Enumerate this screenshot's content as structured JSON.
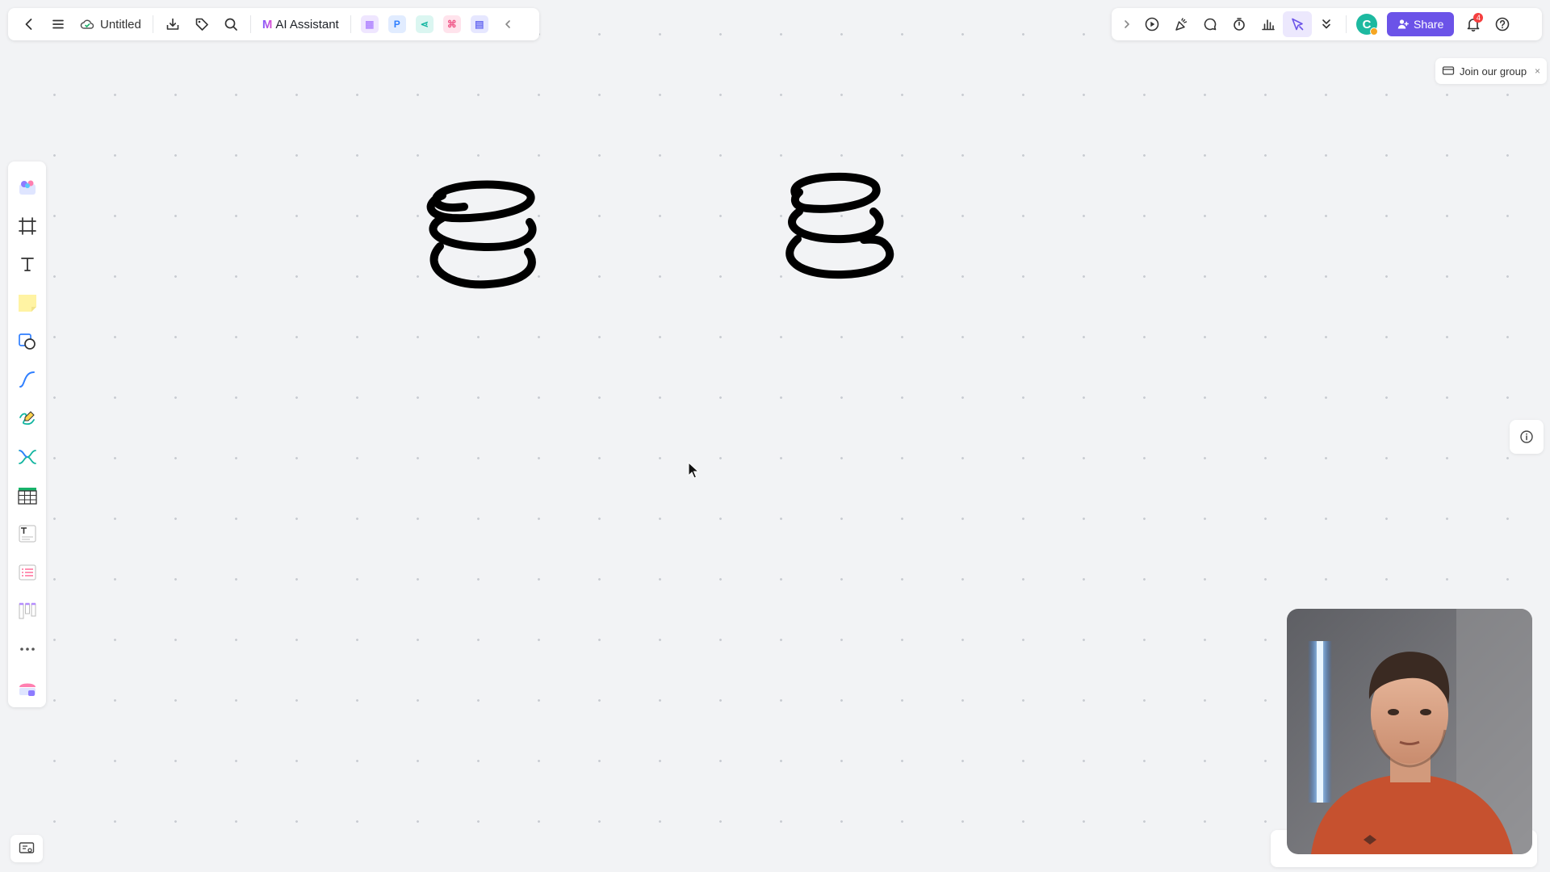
{
  "toolbar": {
    "doc_title": "Untitled",
    "ai_label": "AI Assistant",
    "extensions": [
      {
        "name": "image-ext",
        "glyph": "▦",
        "color": "#b58cff",
        "bg": "#efe6ff"
      },
      {
        "name": "p-ext",
        "glyph": "P",
        "color": "#2f7fff",
        "bg": "#e1ecff"
      },
      {
        "name": "mindmap-ext",
        "glyph": "⋖",
        "color": "#12b5a0",
        "bg": "#dbf6f1"
      },
      {
        "name": "flow-ext",
        "glyph": "⌘",
        "color": "#f05a8a",
        "bg": "#ffe3ec"
      },
      {
        "name": "slide-ext",
        "glyph": "▤",
        "color": "#6a6cf0",
        "bg": "#e6e7ff"
      }
    ]
  },
  "right_toolbar": {
    "avatar_letter": "C",
    "share_label": "Share",
    "notification_count": "4"
  },
  "join_banner": {
    "label": "Join our group",
    "close": "×"
  },
  "colors": {
    "accent": "#6b53e8",
    "canvas": "#f2f3f5"
  }
}
